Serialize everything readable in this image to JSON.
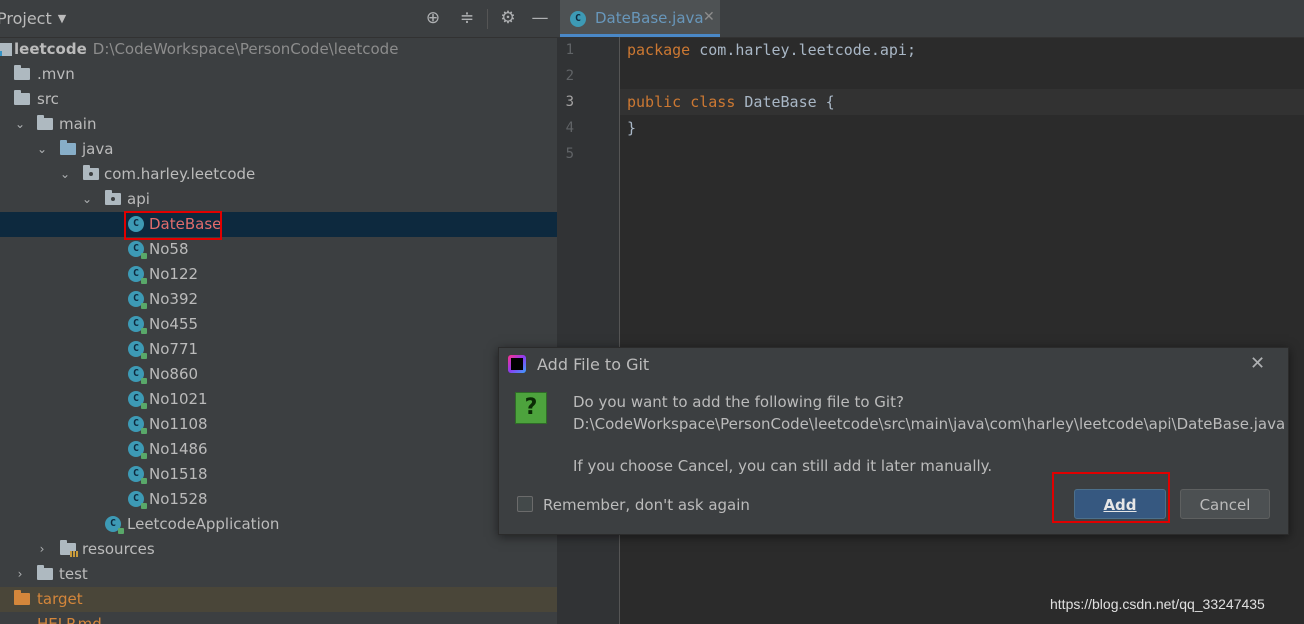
{
  "project_panel": {
    "title": "Project",
    "header_icons": [
      "crosshair-icon",
      "collapse-all-icon",
      "gear-icon",
      "minimize-icon"
    ]
  },
  "tree": {
    "root_name": "leetcode",
    "root_path": "D:\\CodeWorkspace\\PersonCode\\leetcode",
    "mvn": ".mvn",
    "src": "src",
    "main": "main",
    "java": "java",
    "package": "com.harley.leetcode",
    "api": "api",
    "classes": [
      "DateBase",
      "No58",
      "No122",
      "No392",
      "No455",
      "No771",
      "No860",
      "No1021",
      "No1108",
      "No1486",
      "No1518",
      "No1528"
    ],
    "app_class": "LeetcodeApplication",
    "resources": "resources",
    "test": "test",
    "target": "target",
    "help": "HELP.md",
    "class_icon_letter": "C"
  },
  "editor": {
    "tab_label": "DateBase.java",
    "tab_close": "✕",
    "line_numbers": [
      "1",
      "2",
      "3",
      "4",
      "5"
    ],
    "line1_kw": "package",
    "line1_rest": " com.harley.leetcode.api;",
    "line3_kw": "public class",
    "line3_rest": " DateBase {",
    "line4": "}"
  },
  "dialog": {
    "title": "Add File to Git",
    "close": "✕",
    "question_icon": "?",
    "line1": "Do you want to add the following file to Git?",
    "line2": "D:\\CodeWorkspace\\PersonCode\\leetcode\\src\\main\\java\\com\\harley\\leetcode\\api\\DateBase.java",
    "line3": "If you choose Cancel, you can still add it later manually.",
    "remember_label": "Remember, don't ask again",
    "add_label": "Add",
    "cancel_label": "Cancel",
    "remember_checked": false
  },
  "watermark": "https://blog.csdn.net/qq_33247435",
  "colors": {
    "panel_bg": "#3c3f41",
    "editor_bg": "#2b2b2b",
    "keyword": "#cc7832",
    "selection": "#0d293e",
    "highlight_red": "#e00000",
    "primary_button": "#365880"
  }
}
